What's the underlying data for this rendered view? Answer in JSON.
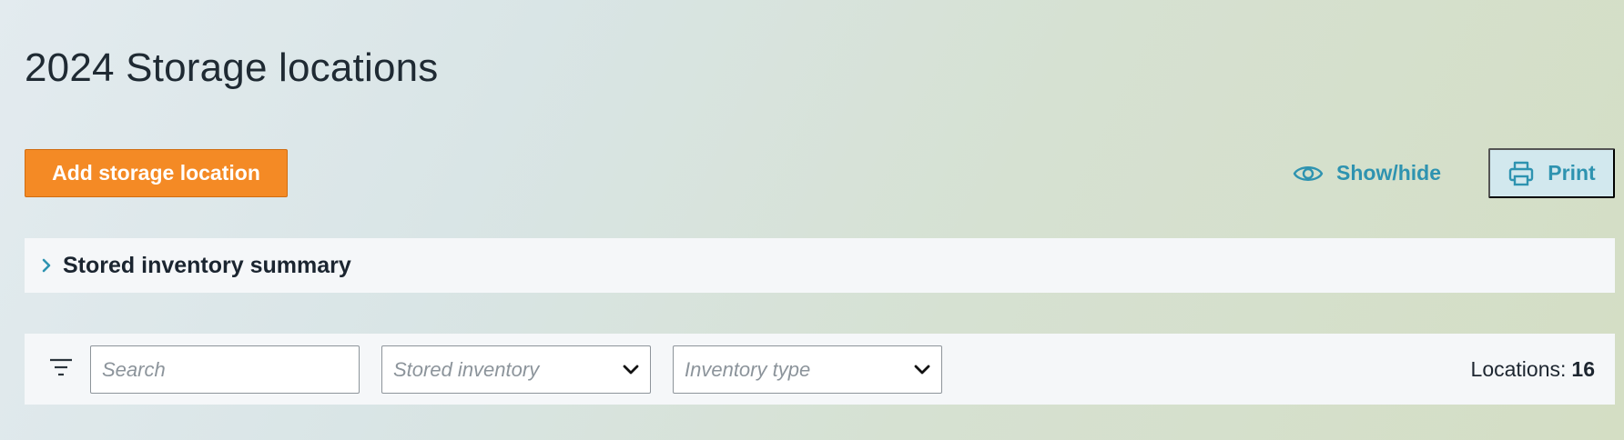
{
  "page": {
    "title": "2024 Storage locations"
  },
  "toolbar": {
    "add_label": "Add storage location",
    "showhide_label": "Show/hide",
    "print_label": "Print"
  },
  "summary": {
    "title": "Stored inventory summary",
    "expanded": false
  },
  "filters": {
    "search_placeholder": "Search",
    "stored_inventory_placeholder": "Stored inventory",
    "inventory_type_placeholder": "Inventory type",
    "count_label": "Locations:",
    "count_value": "16"
  },
  "colors": {
    "accent_orange": "#f48a25",
    "link_teal": "#2e93b0",
    "print_bg": "#d2e8ee",
    "panel_bg": "#f5f7f9"
  },
  "icons": {
    "showhide": "eye-icon",
    "print": "printer-icon",
    "expand": "chevron-right-icon",
    "filter": "filter-icon",
    "dropdown": "chevron-down-icon"
  }
}
